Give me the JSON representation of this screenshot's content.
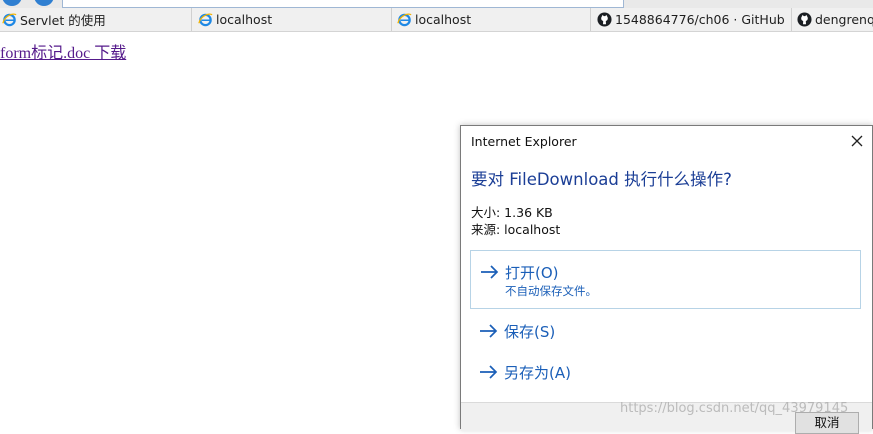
{
  "browser": {
    "accent_color": "#2f7fd1",
    "favorites": [
      {
        "label": "Servlet 的使用",
        "icon": "ie-icon"
      },
      {
        "label": "localhost",
        "icon": "ie-icon"
      },
      {
        "label": "localhost",
        "icon": "ie-icon"
      },
      {
        "label": "1548864776/ch06 · GitHub",
        "icon": "github-icon"
      },
      {
        "label": "dengrenq",
        "icon": "github-icon"
      }
    ]
  },
  "page": {
    "download_link": "form标记.doc 下载"
  },
  "dialog": {
    "title": "Internet Explorer",
    "question": "要对 FileDownload 执行什么操作?",
    "size_line": "大小: 1.36 KB",
    "source_line": "来源: localhost",
    "options": [
      {
        "label": "打开(O)",
        "sub": "不自动保存文件。",
        "icon": "arrow-right-icon"
      },
      {
        "label": "保存(S)",
        "icon": "arrow-right-icon"
      },
      {
        "label": "另存为(A)",
        "icon": "arrow-right-icon"
      }
    ],
    "cancel_label": "取消",
    "link_color": "#1b5fb8",
    "heading_color": "#1b3e96"
  },
  "watermark": "https://blog.csdn.net/qq_43979145"
}
